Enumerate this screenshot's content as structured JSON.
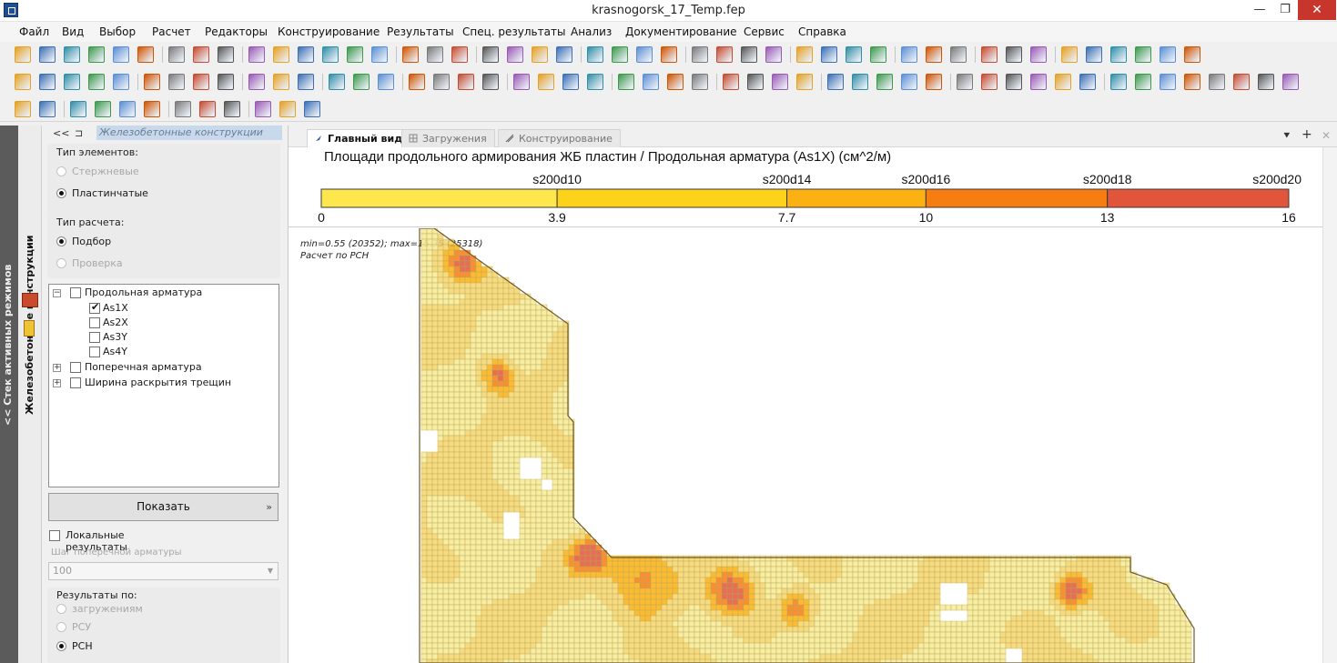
{
  "window": {
    "title": "krasnogorsk_17_Temp.fep",
    "minimize": "—",
    "maximize": "❐",
    "close": "✕"
  },
  "menu": [
    "Файл",
    "Вид",
    "Выбор",
    "Расчет",
    "Редакторы",
    "Конструирование",
    "Результаты",
    "Спец. результаты",
    "Анализ",
    "Документирование",
    "Сервис",
    "Справка"
  ],
  "side_strip": {
    "outer_label": "<< Стек активных режимов",
    "inner_label": "Железобетонные конструкции"
  },
  "left_panel": {
    "nav_back": "<<",
    "nav_pin": "⊐",
    "title": "Железобетонные конструкции",
    "element_type": {
      "label": "Тип элементов:",
      "options": [
        {
          "label": "Стержневые",
          "selected": false,
          "enabled": false
        },
        {
          "label": "Пластинчатые",
          "selected": true,
          "enabled": true
        }
      ]
    },
    "calc_type": {
      "label": "Тип расчета:",
      "options": [
        {
          "label": "Подбор",
          "selected": true,
          "enabled": true
        },
        {
          "label": "Проверка",
          "selected": false,
          "enabled": false
        }
      ]
    },
    "tree": {
      "root": "Продольная арматура",
      "children": [
        {
          "label": "As1X",
          "checked": true
        },
        {
          "label": "As2X",
          "checked": false
        },
        {
          "label": "As3Y",
          "checked": false
        },
        {
          "label": "As4Y",
          "checked": false
        }
      ],
      "others": [
        "Поперечная арматура",
        "Ширина раскрытия трещин"
      ],
      "collapse_sign": "−",
      "expand_sign": "+"
    },
    "show_button": "Показать",
    "show_arrow": "»",
    "local_results": "Локальные результаты",
    "step_label": "Шаг поперечной арматуры",
    "step_value": "100",
    "step_dd": "▼",
    "results_by": {
      "label": "Результаты по:",
      "options": [
        {
          "label": "загружениям",
          "selected": false,
          "enabled": false
        },
        {
          "label": "РСУ",
          "selected": false,
          "enabled": false
        },
        {
          "label": "РСН",
          "selected": true,
          "enabled": true
        }
      ]
    }
  },
  "tabs": [
    {
      "label": "Главный вид",
      "active": true
    },
    {
      "label": "Загружения",
      "active": false
    },
    {
      "label": "Конструирование",
      "active": false
    }
  ],
  "tab_controls": {
    "menu": "⯆",
    "add": "+",
    "close": "✕"
  },
  "legend": {
    "title": "Площади продольного армирования ЖБ пластин / Продольная арматура (As1X) (см^2/м)",
    "top_labels": [
      "s200d10",
      "s200d14",
      "s200d16",
      "s200d18",
      "s200d20"
    ],
    "ticks": [
      "0",
      "3.9",
      "7.7",
      "10",
      "13",
      "16"
    ],
    "tick_values": [
      0,
      3.9,
      7.7,
      10,
      13,
      16
    ],
    "colors": [
      "#fde74c",
      "#fdd21a",
      "#fbb111",
      "#f77c12",
      "#e1553a"
    ]
  },
  "model_info": {
    "line1": "min=0.55 (20352); max=15.35 (25318)",
    "line2": "Расчет по РСН"
  }
}
